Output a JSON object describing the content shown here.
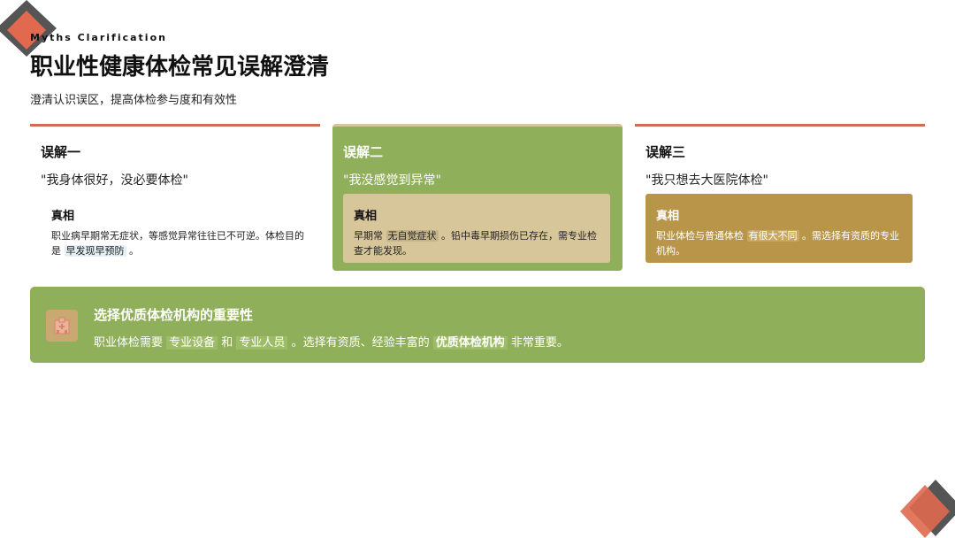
{
  "header": {
    "kicker": "Myths Clarification",
    "title": "职业性健康体检常见误解澄清",
    "subtitle": "澄清认识误区，提高体检参与度和有效性"
  },
  "cards": [
    {
      "title": "误解一",
      "quote": "\"我身体很好，没必要体检\"",
      "truth_label": "真相",
      "truth_text_before": "职业病早期常无症状，等感觉异常往往已不可逆。体检目的是 ",
      "truth_highlight": "早发现早预防",
      "truth_text_after": " 。"
    },
    {
      "title": "误解二",
      "quote": "\"我没感觉到异常\"",
      "truth_label": "真相",
      "truth_text_before": "早期常 ",
      "truth_highlight": "无自觉症状",
      "truth_text_after": " 。铅中毒早期损伤已存在，需专业检查才能发现。"
    },
    {
      "title": "误解三",
      "quote": "\"我只想去大医院体检\"",
      "truth_label": "真相",
      "truth_text_before": "职业体检与普通体检 ",
      "truth_highlight": "有很大不同",
      "truth_text_after": " 。需选择有资质的专业机构。"
    }
  ],
  "banner": {
    "icon": "hospital-icon",
    "title": "选择优质体检机构的重要性",
    "text_1": "职业体检需要 ",
    "hl_1": "专业设备",
    "text_2": " 和 ",
    "hl_2": "专业人员",
    "text_3": " 。选择有资质、经验丰富的 ",
    "hl_3": "优质体检机构",
    "text_4": " 非常重要。"
  },
  "colors": {
    "accent_red": "#d16b55",
    "green": "#8faf5b",
    "tan": "#d8c69b",
    "mustard": "#b9954a",
    "dark_gray": "#555555"
  }
}
